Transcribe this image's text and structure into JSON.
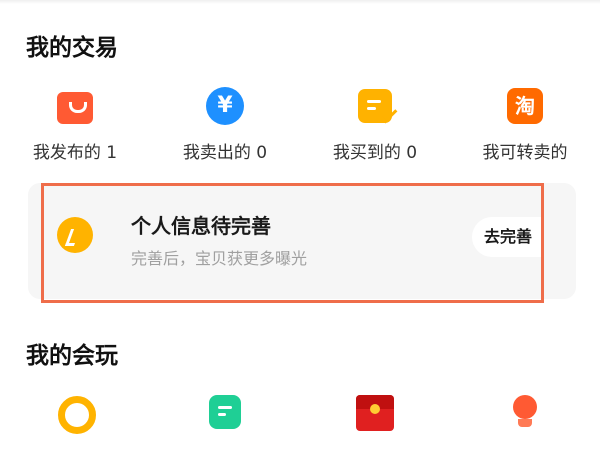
{
  "trade": {
    "title": "我的交易",
    "items": [
      {
        "label": "我发布的 1",
        "icon": "shopping-bag-icon"
      },
      {
        "label": "我卖出的 0",
        "icon": "yen-coin-icon"
      },
      {
        "label": "我买到的 0",
        "icon": "checklist-icon"
      },
      {
        "label": "我可转卖的",
        "icon": "taobao-icon"
      }
    ]
  },
  "profile_card": {
    "title": "个人信息待完善",
    "subtitle": "完善后，宝贝获更多曝光",
    "button": "去完善",
    "icon": "edit-pen-icon",
    "highlight_color": "#ef6d4a"
  },
  "play": {
    "title": "我的会玩",
    "items": [
      {
        "icon": "ring-icon"
      },
      {
        "icon": "note-icon"
      },
      {
        "icon": "red-envelope-icon"
      },
      {
        "icon": "lightbulb-icon"
      }
    ]
  },
  "colors": {
    "orange": "#ff5a33",
    "blue": "#1e90ff",
    "yellow": "#ffb200",
    "green": "#1fcf95",
    "red": "#e02020"
  }
}
